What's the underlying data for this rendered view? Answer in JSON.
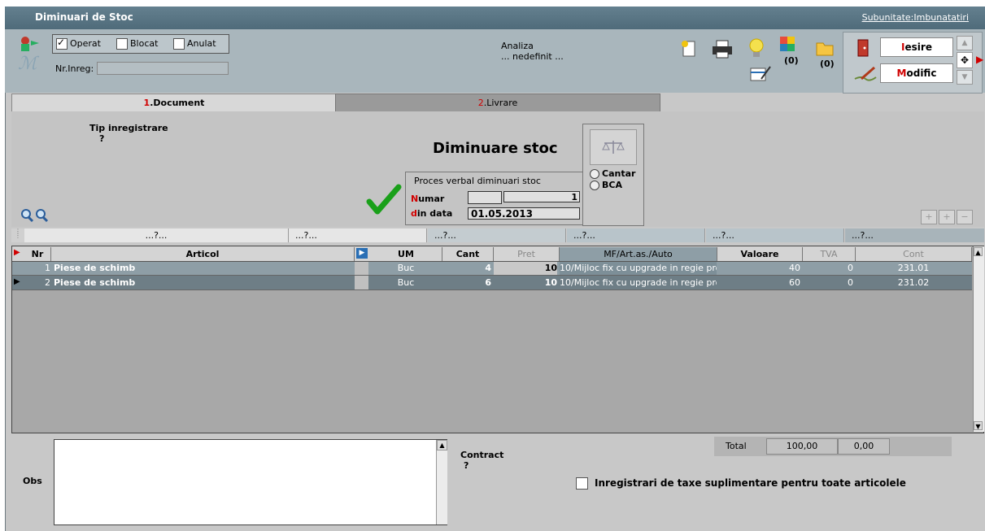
{
  "window": {
    "title": "Diminuari de Stoc",
    "subunit_link": "Subunitate:Imbunatatiri"
  },
  "status": {
    "operat": "Operat",
    "blocat": "Blocat",
    "anulat": "Anulat",
    "operat_checked": true,
    "nr_inreg_label": "Nr.Inreg:",
    "nr_inreg_value": ""
  },
  "analiza": {
    "label": "Analiza",
    "value": "... nedefinit ..."
  },
  "counters": {
    "c1": "(0)",
    "c2": "(0)"
  },
  "buttons": {
    "iesire_first": "I",
    "iesire_rest": "esire",
    "modific_first": "M",
    "modific_rest": "odific"
  },
  "tabs": {
    "document_num": "1",
    "document_label": ".Document",
    "livrare_num": "2",
    "livrare_label": ".Livrare"
  },
  "form": {
    "tip_label": "Tip inregistrare",
    "tip_value": "?",
    "heading": "Diminuare stoc",
    "pv_label": "Proces verbal diminuari stoc",
    "numar_first": "N",
    "numar_rest": "umar",
    "numar_series": "",
    "numar_value": "1",
    "data_first": "d",
    "data_rest": "in data",
    "data_value": "01.05.2013",
    "cantar": "Cantar",
    "bca": "BCA"
  },
  "filters": [
    "...?...",
    "...?...",
    "...?...",
    "...?...",
    "...?...",
    "...?..."
  ],
  "table": {
    "headers": {
      "nr": "Nr",
      "articol": "Articol",
      "um": "UM",
      "cant": "Cant",
      "pret": "Pret",
      "mf": "MF/Art.as./Auto",
      "valoare": "Valoare",
      "tva": "TVA",
      "cont": "Cont"
    },
    "rows": [
      {
        "nr": "1",
        "articol": "Piese de schimb",
        "um": "Buc",
        "cant": "4",
        "pret": "10",
        "mf": "10/Mijloc fix cu upgrade in regie prop",
        "valoare": "40",
        "tva": "0",
        "cont": "231.01"
      },
      {
        "nr": "2",
        "articol": "Piese de schimb",
        "um": "Buc",
        "cant": "6",
        "pret": "10",
        "mf": "10/Mijloc fix cu upgrade in regie prop",
        "valoare": "60",
        "tva": "0",
        "cont": "231.02"
      }
    ]
  },
  "footer": {
    "obs_label": "Obs",
    "obs_value": "",
    "contract_label": "Contract",
    "contract_value": "?",
    "total_label": "Total",
    "total_value": "100,00",
    "total_tva": "0,00",
    "taxe_label": "Inregistrari de taxe suplimentare pentru toate articolele"
  },
  "colors": {
    "titlebar": "#577383",
    "selected_row": "#6e7e86",
    "alt_row": "#8e9ea6",
    "accent_red": "#d00000",
    "check_green": "#1aa01a"
  },
  "icons": [
    "user-arrow-icon",
    "script-m-icon",
    "new-document-icon",
    "printer-icon",
    "lightbulb-icon",
    "cube-icon",
    "folder-icon",
    "calendar-edit-icon",
    "exit-door-icon",
    "pen-icon",
    "scale-icon",
    "magnifier-icon",
    "green-check-icon"
  ]
}
